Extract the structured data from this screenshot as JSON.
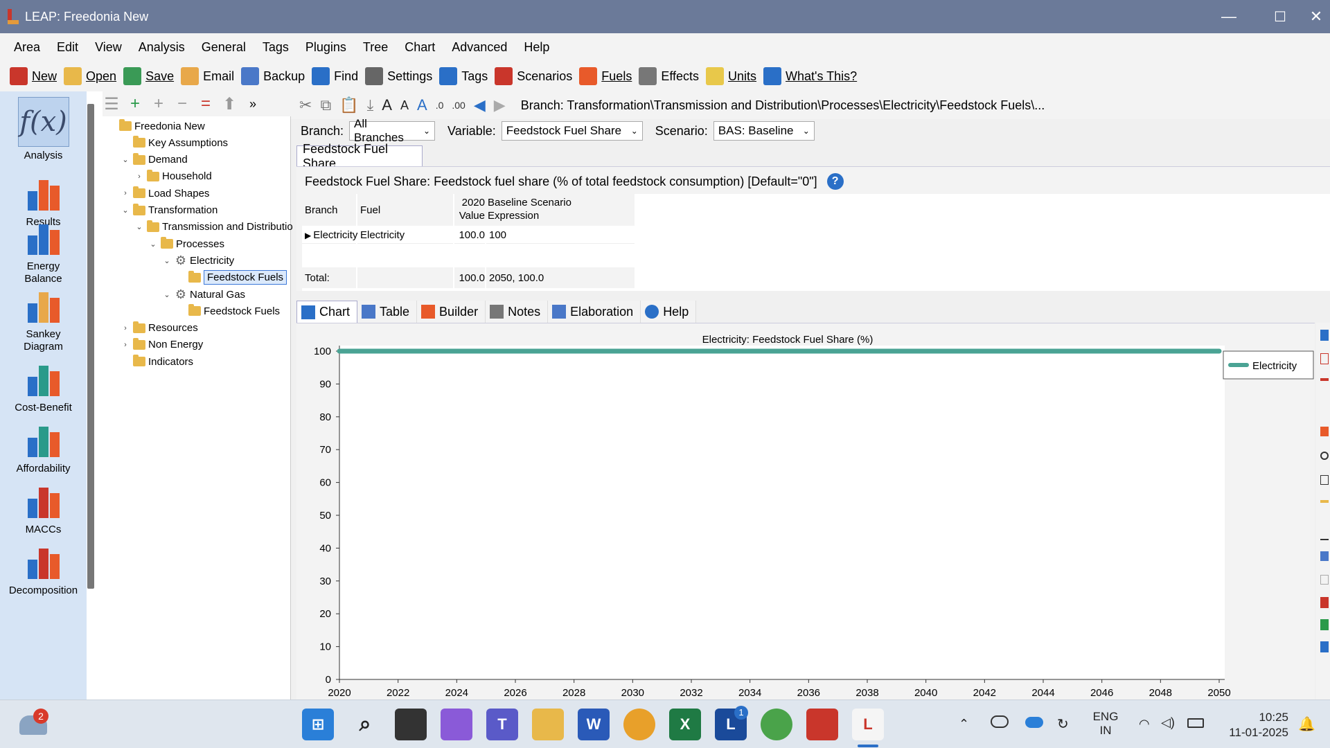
{
  "window": {
    "title": "LEAP: Freedonia New",
    "minimize": "—",
    "maximize": "☐",
    "close": "✕"
  },
  "menu": [
    "Area",
    "Edit",
    "View",
    "Analysis",
    "General",
    "Tags",
    "Plugins",
    "Tree",
    "Chart",
    "Advanced",
    "Help"
  ],
  "toolbar": [
    {
      "label": "New",
      "icon": "new-icon",
      "color": "#c9362b"
    },
    {
      "label": "Open",
      "icon": "open-folder-icon",
      "color": "#e8b84a"
    },
    {
      "label": "Save",
      "icon": "save-icon",
      "color": "#3a9a56"
    },
    {
      "label": "Email",
      "icon": "email-icon",
      "color": "#e8a84a"
    },
    {
      "label": "Backup",
      "icon": "backup-icon",
      "color": "#4a78c8"
    },
    {
      "label": "Find",
      "icon": "find-icon",
      "color": "#2a6fc7"
    },
    {
      "label": "Settings",
      "icon": "settings-icon",
      "color": "#666666"
    },
    {
      "label": "Tags",
      "icon": "tag-icon",
      "color": "#2a6fc7"
    },
    {
      "label": "Scenarios",
      "icon": "scenarios-icon",
      "color": "#c9362b"
    },
    {
      "label": "Fuels",
      "icon": "fuels-icon",
      "color": "#e85a2a"
    },
    {
      "label": "Effects",
      "icon": "effects-icon",
      "color": "#777777"
    },
    {
      "label": "Units",
      "icon": "units-icon",
      "color": "#e8c84a"
    },
    {
      "label": "What's This?",
      "icon": "help-icon",
      "color": "#2a6fc7"
    }
  ],
  "leftnav": [
    {
      "label": "Analysis",
      "icon": "fx-icon"
    },
    {
      "label": "Results",
      "icon": "results-chart-icon"
    },
    {
      "label": "Energy\nBalance",
      "icon": "energy-balance-icon"
    },
    {
      "label": "Sankey\nDiagram",
      "icon": "sankey-icon"
    },
    {
      "label": "Cost-Benefit",
      "icon": "cost-benefit-icon"
    },
    {
      "label": "Affordability",
      "icon": "affordability-icon"
    },
    {
      "label": "MACCs",
      "icon": "maccs-icon"
    },
    {
      "label": "Decomposition",
      "icon": "decomposition-icon"
    }
  ],
  "tree": [
    {
      "label": "Freedonia New",
      "level": 0,
      "exp": "",
      "kind": "folder"
    },
    {
      "label": "Key Assumptions",
      "level": 1,
      "exp": "",
      "kind": "folder"
    },
    {
      "label": "Demand",
      "level": 1,
      "exp": "⌄",
      "kind": "folder"
    },
    {
      "label": "Household",
      "level": 2,
      "exp": "›",
      "kind": "folder"
    },
    {
      "label": "Load Shapes",
      "level": 1,
      "exp": "›",
      "kind": "folder"
    },
    {
      "label": "Transformation",
      "level": 1,
      "exp": "⌄",
      "kind": "folder"
    },
    {
      "label": "Transmission and Distributio",
      "level": 2,
      "exp": "⌄",
      "kind": "folder"
    },
    {
      "label": "Processes",
      "level": 3,
      "exp": "⌄",
      "kind": "folder"
    },
    {
      "label": "Electricity",
      "level": 4,
      "exp": "⌄",
      "kind": "gear"
    },
    {
      "label": "Feedstock Fuels",
      "level": 5,
      "exp": "",
      "kind": "folder",
      "selected": true
    },
    {
      "label": "Natural Gas",
      "level": 4,
      "exp": "⌄",
      "kind": "gear"
    },
    {
      "label": "Feedstock Fuels",
      "level": 5,
      "exp": "",
      "kind": "folder"
    },
    {
      "label": "Resources",
      "level": 1,
      "exp": "›",
      "kind": "folder"
    },
    {
      "label": "Non Energy",
      "level": 1,
      "exp": "›",
      "kind": "folder"
    },
    {
      "label": "Indicators",
      "level": 1,
      "exp": "",
      "kind": "folder"
    }
  ],
  "breadcrumb": "Branch: Transformation\\Transmission and Distribution\\Processes\\Electricity\\Feedstock Fuels\\...",
  "selectors": {
    "branch_label": "Branch:",
    "branch_value": "All Branches",
    "variable_label": "Variable:",
    "variable_value": "Feedstock Fuel Share",
    "scenario_label": "Scenario:",
    "scenario_value": "BAS: Baseline"
  },
  "variable_tab": "Feedstock Fuel Share",
  "variable_desc": "Feedstock Fuel Share: Feedstock fuel share (% of total feedstock consumption) [Default=\"0\"]",
  "grid": {
    "headers": {
      "branch": "Branch",
      "fuel": "Fuel",
      "year": "2020",
      "scenario": "Baseline Scenario",
      "value": "Value",
      "expression": "Expression"
    },
    "row": {
      "branch": "Electricity",
      "fuel": "Electricity",
      "value": "100.0",
      "expression": "100"
    },
    "total": {
      "label": "Total:",
      "value": "100.0",
      "expression": "2050, 100.0"
    }
  },
  "bottom_tabs": [
    {
      "label": "Chart",
      "icon": "chart-icon",
      "color": "#2a6fc7"
    },
    {
      "label": "Table",
      "icon": "table-icon",
      "color": "#4a78c8"
    },
    {
      "label": "Builder",
      "icon": "builder-icon",
      "color": "#e85a2a"
    },
    {
      "label": "Notes",
      "icon": "notes-icon",
      "color": "#777777"
    },
    {
      "label": "Elaboration",
      "icon": "elaboration-icon",
      "color": "#4a78c8"
    },
    {
      "label": "Help",
      "icon": "help-icon",
      "color": "#2a6fc7"
    }
  ],
  "chart_data": {
    "type": "line",
    "title": "Electricity: Feedstock Fuel Share (%)",
    "x": [
      2020,
      2022,
      2024,
      2026,
      2028,
      2030,
      2032,
      2034,
      2036,
      2038,
      2040,
      2042,
      2044,
      2046,
      2048,
      2050
    ],
    "xticks": [
      "2020",
      "2022",
      "2024",
      "2026",
      "2028",
      "2030",
      "2032",
      "2034",
      "2036",
      "2038",
      "2040",
      "2042",
      "2044",
      "2046",
      "2048",
      "2050"
    ],
    "yticks": [
      "0",
      "10",
      "20",
      "30",
      "40",
      "50",
      "60",
      "70",
      "80",
      "90",
      "100"
    ],
    "ylim": [
      0,
      100
    ],
    "series": [
      {
        "name": "Electricity",
        "color": "#4aa394",
        "values": [
          100,
          100,
          100,
          100,
          100,
          100,
          100,
          100,
          100,
          100,
          100,
          100,
          100,
          100,
          100,
          100
        ]
      }
    ],
    "legend_position": "right"
  },
  "taskbar": {
    "weather_badge": "2",
    "teams_badge": "1",
    "lang_line1": "ENG",
    "lang_line2": "IN",
    "time": "10:25",
    "date": "11-01-2025"
  }
}
